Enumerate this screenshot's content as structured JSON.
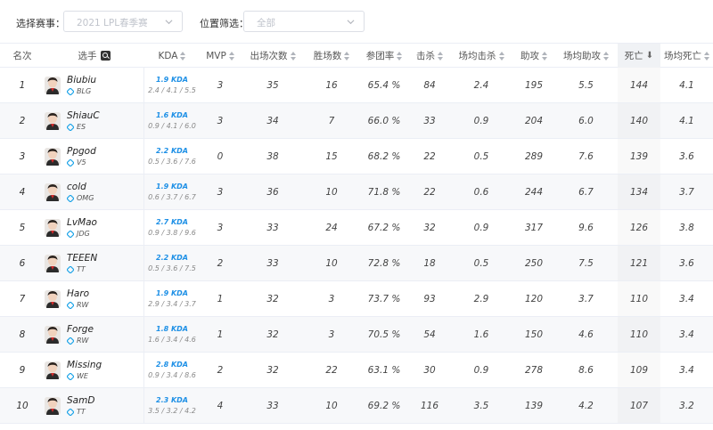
{
  "filters": {
    "event_label": "选择赛事：",
    "event_value": "2021 LPL春季赛",
    "pos_label": "位置筛选：",
    "pos_value": "全部"
  },
  "headers": {
    "rank": "名次",
    "player": "选手",
    "kda": "KDA",
    "mvp": "MVP",
    "games": "出场次数",
    "wins": "胜场数",
    "kp": "参团率",
    "kills": "击杀",
    "avg_kills": "场均击杀",
    "assists": "助攻",
    "avg_assists": "场均助攻",
    "deaths": "死亡",
    "avg_deaths": "场均死亡"
  },
  "sort_column": "deaths",
  "rows": [
    {
      "rank": "1",
      "name": "Biubiu",
      "team": "BLG",
      "kda": "1.9 KDA",
      "kda_detail": "2.4 / 4.1 / 5.5",
      "mvp": "3",
      "games": "35",
      "wins": "16",
      "kp": "65.4 %",
      "kills": "84",
      "avg_kills": "2.4",
      "assists": "195",
      "avg_assists": "5.5",
      "deaths": "144",
      "avg_deaths": "4.1"
    },
    {
      "rank": "2",
      "name": "ShiauC",
      "team": "ES",
      "kda": "1.6 KDA",
      "kda_detail": "0.9 / 4.1 / 6.0",
      "mvp": "3",
      "games": "34",
      "wins": "7",
      "kp": "66.0 %",
      "kills": "33",
      "avg_kills": "0.9",
      "assists": "204",
      "avg_assists": "6.0",
      "deaths": "140",
      "avg_deaths": "4.1"
    },
    {
      "rank": "3",
      "name": "Ppgod",
      "team": "V5",
      "kda": "2.2 KDA",
      "kda_detail": "0.5 / 3.6 / 7.6",
      "mvp": "0",
      "games": "38",
      "wins": "15",
      "kp": "68.2 %",
      "kills": "22",
      "avg_kills": "0.5",
      "assists": "289",
      "avg_assists": "7.6",
      "deaths": "139",
      "avg_deaths": "3.6"
    },
    {
      "rank": "4",
      "name": "cold",
      "team": "OMG",
      "kda": "1.9 KDA",
      "kda_detail": "0.6 / 3.7 / 6.7",
      "mvp": "3",
      "games": "36",
      "wins": "10",
      "kp": "71.8 %",
      "kills": "22",
      "avg_kills": "0.6",
      "assists": "244",
      "avg_assists": "6.7",
      "deaths": "134",
      "avg_deaths": "3.7"
    },
    {
      "rank": "5",
      "name": "LvMao",
      "team": "JDG",
      "kda": "2.7 KDA",
      "kda_detail": "0.9 / 3.8 / 9.6",
      "mvp": "3",
      "games": "33",
      "wins": "24",
      "kp": "67.2 %",
      "kills": "32",
      "avg_kills": "0.9",
      "assists": "317",
      "avg_assists": "9.6",
      "deaths": "126",
      "avg_deaths": "3.8"
    },
    {
      "rank": "6",
      "name": "TEEEN",
      "team": "TT",
      "kda": "2.2 KDA",
      "kda_detail": "0.5 / 3.6 / 7.5",
      "mvp": "2",
      "games": "33",
      "wins": "10",
      "kp": "72.8 %",
      "kills": "18",
      "avg_kills": "0.5",
      "assists": "250",
      "avg_assists": "7.5",
      "deaths": "121",
      "avg_deaths": "3.6"
    },
    {
      "rank": "7",
      "name": "Haro",
      "team": "RW",
      "kda": "1.9 KDA",
      "kda_detail": "2.9 / 3.4 / 3.7",
      "mvp": "1",
      "games": "32",
      "wins": "3",
      "kp": "73.7 %",
      "kills": "93",
      "avg_kills": "2.9",
      "assists": "120",
      "avg_assists": "3.7",
      "deaths": "110",
      "avg_deaths": "3.4"
    },
    {
      "rank": "8",
      "name": "Forge",
      "team": "RW",
      "kda": "1.8 KDA",
      "kda_detail": "1.6 / 3.4 / 4.6",
      "mvp": "1",
      "games": "32",
      "wins": "3",
      "kp": "70.5 %",
      "kills": "54",
      "avg_kills": "1.6",
      "assists": "150",
      "avg_assists": "4.6",
      "deaths": "110",
      "avg_deaths": "3.4"
    },
    {
      "rank": "9",
      "name": "Missing",
      "team": "WE",
      "kda": "2.8 KDA",
      "kda_detail": "0.9 / 3.4 / 8.6",
      "mvp": "2",
      "games": "32",
      "wins": "22",
      "kp": "63.1 %",
      "kills": "30",
      "avg_kills": "0.9",
      "assists": "278",
      "avg_assists": "8.6",
      "deaths": "109",
      "avg_deaths": "3.4"
    },
    {
      "rank": "10",
      "name": "SamD",
      "team": "TT",
      "kda": "2.3 KDA",
      "kda_detail": "3.5 / 3.2 / 4.2",
      "mvp": "4",
      "games": "33",
      "wins": "10",
      "kp": "69.2 %",
      "kills": "116",
      "avg_kills": "3.5",
      "assists": "139",
      "avg_assists": "4.2",
      "deaths": "107",
      "avg_deaths": "3.2"
    }
  ],
  "colors": {
    "kda_blue": "#1e90e6",
    "team_logo_blue": "#1aa3e8"
  }
}
